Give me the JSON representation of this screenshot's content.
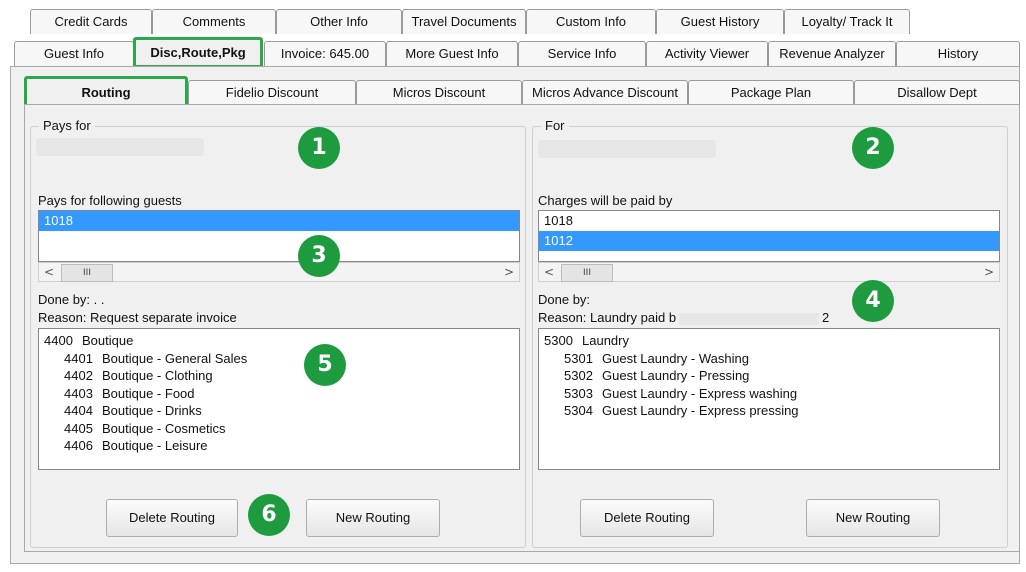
{
  "tabs_row1": [
    {
      "label": "Credit Cards"
    },
    {
      "label": "Comments"
    },
    {
      "label": "Other Info"
    },
    {
      "label": "Travel Documents"
    },
    {
      "label": "Custom Info"
    },
    {
      "label": "Guest History"
    },
    {
      "label": "Loyalty/ Track It"
    }
  ],
  "tabs_row2": [
    {
      "label": "Guest Info"
    },
    {
      "label": "Disc,Route,Pkg"
    },
    {
      "label": "Invoice: 645.00"
    },
    {
      "label": "More Guest Info"
    },
    {
      "label": "Service Info"
    },
    {
      "label": "Activity Viewer"
    },
    {
      "label": "Revenue Analyzer"
    },
    {
      "label": "History"
    }
  ],
  "subtabs": [
    {
      "label": "Routing"
    },
    {
      "label": "Fidelio Discount"
    },
    {
      "label": "Micros Discount"
    },
    {
      "label": "Micros Advance Discount"
    },
    {
      "label": "Package Plan"
    },
    {
      "label": "Disallow Dept"
    }
  ],
  "left": {
    "group_label": "Pays for",
    "list_label": "Pays for following guests",
    "guests": [
      {
        "id": "1018"
      }
    ],
    "done_by": "Done by: . .",
    "reason": "Reason: Request separate invoice",
    "departments": [
      {
        "code": "4400",
        "name": "Boutique"
      },
      {
        "code": "4401",
        "name": "Boutique - General Sales"
      },
      {
        "code": "4402",
        "name": "Boutique - Clothing"
      },
      {
        "code": "4403",
        "name": "Boutique - Food"
      },
      {
        "code": "4404",
        "name": "Boutique - Drinks"
      },
      {
        "code": "4405",
        "name": "Boutique - Cosmetics"
      },
      {
        "code": "4406",
        "name": "Boutique - Leisure"
      }
    ],
    "delete_label": "Delete Routing",
    "new_label": "New Routing"
  },
  "right": {
    "group_label": "For",
    "list_label": "Charges will be paid by",
    "guests": [
      {
        "id": "1018"
      },
      {
        "id": "1012"
      }
    ],
    "done_by": "Done by:",
    "reason_start": "Reason: Laundry paid b",
    "reason_end": "2",
    "departments": [
      {
        "code": "5300",
        "name": "Laundry"
      },
      {
        "code": "5301",
        "name": "Guest Laundry - Washing"
      },
      {
        "code": "5302",
        "name": "Guest Laundry - Pressing"
      },
      {
        "code": "5303",
        "name": "Guest Laundry - Express washing"
      },
      {
        "code": "5304",
        "name": "Guest Laundry - Express pressing"
      }
    ],
    "delete_label": "Delete Routing",
    "new_label": "New Routing"
  },
  "scroll_thumb": "III",
  "scroll_left": "<",
  "scroll_right": ">",
  "callouts": [
    "1",
    "2",
    "3",
    "4",
    "5",
    "6"
  ],
  "colors": {
    "highlight": "#2aa84a",
    "callout": "#1e9b3e",
    "selection": "#3399ff"
  }
}
